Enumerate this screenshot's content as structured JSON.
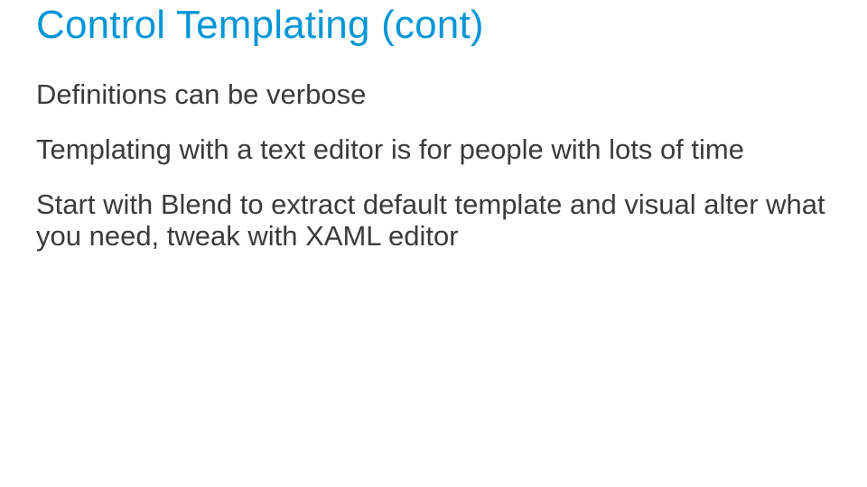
{
  "slide": {
    "title": "Control Templating (cont)",
    "bullets": [
      "Definitions can be verbose",
      "Templating with a text editor is for people with lots of time",
      "Start with Blend to extract default template and visual alter what you need, tweak with XAML editor"
    ]
  }
}
